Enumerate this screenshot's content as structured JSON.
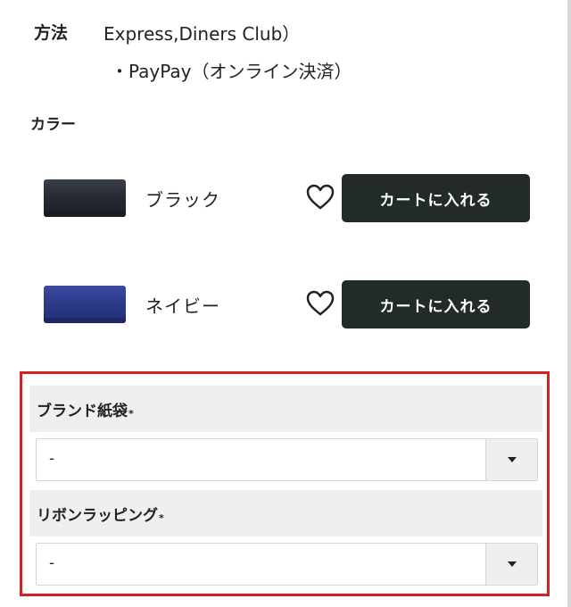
{
  "payment": {
    "label": "方法",
    "line1": "Express,Diners Club）",
    "line2": "・PayPay（オンライン決済）"
  },
  "color": {
    "heading": "カラー",
    "variants": [
      {
        "name": "ブラック",
        "swatch": "#2a2e37",
        "cart_label": "カートに入れる"
      },
      {
        "name": "ネイビー",
        "swatch": "#2c3a8a",
        "cart_label": "カートに入れる"
      }
    ]
  },
  "options": {
    "highlight_color": "#d31f26",
    "bag": {
      "label": "ブランド紙袋",
      "required_mark": "*",
      "value": "-"
    },
    "ribbon": {
      "label": "リボンラッピング",
      "required_mark": "*",
      "value": "-"
    }
  },
  "icons": {
    "favorite": "heart-outline-icon",
    "dropdown": "caret-down-icon"
  }
}
